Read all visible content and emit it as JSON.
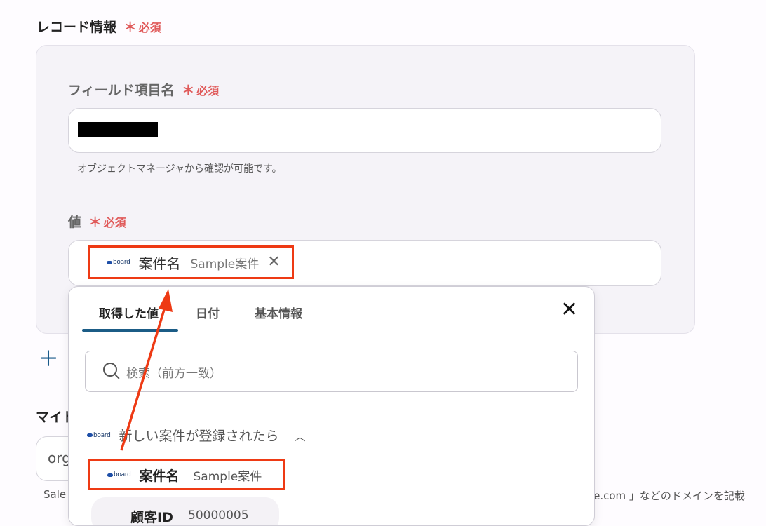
{
  "section": {
    "title": "レコード情報",
    "required_star": "＊",
    "required_label": "必須"
  },
  "field_name": {
    "label": "フィールド項目名",
    "required_star": "＊",
    "required_label": "必須",
    "hint": "オブジェクトマネージャから確認が可能です。"
  },
  "value_field": {
    "label": "値",
    "required_star": "＊",
    "required_label": "必須",
    "chip": {
      "app_logo": "board",
      "name": "案件名",
      "value": "Sample案件"
    }
  },
  "left": {
    "my_label": "マイド",
    "input_prefix": "org",
    "hint_prefix": "Sale",
    "hint_suffix": "rce.com 」などのドメインを記載"
  },
  "popup": {
    "tabs": [
      {
        "label": "取得した値"
      },
      {
        "label": "日付"
      },
      {
        "label": "基本情報"
      }
    ],
    "search_placeholder": "検索（前方一致）",
    "group": {
      "app_logo": "board",
      "title": "新しい案件が登録されたら"
    },
    "items": [
      {
        "app_logo": "board",
        "name": "案件名",
        "value": "Sample案件"
      },
      {
        "name": "顧客ID",
        "value": "50000005"
      }
    ]
  },
  "colors": {
    "highlight": "#ee3a14",
    "required": "#e05a5a",
    "accent": "#1b5c86"
  }
}
